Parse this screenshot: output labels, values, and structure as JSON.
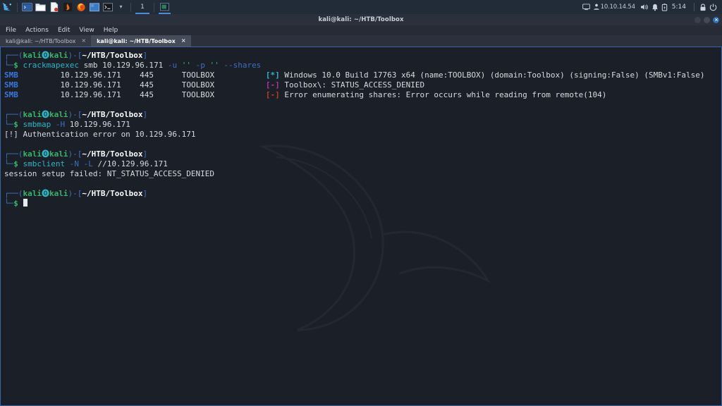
{
  "taskbar": {
    "left_items": [
      {
        "name": "kali-menu-icon",
        "label": "Kali Menu"
      },
      {
        "name": "terminal-emulator-icon",
        "label": "Terminal Emulator"
      },
      {
        "name": "file-manager-icon",
        "label": "File Manager"
      },
      {
        "name": "text-editor-icon",
        "label": "Text Editor"
      },
      {
        "name": "burpsuite-icon",
        "label": "Burp Suite"
      },
      {
        "name": "firefox-icon",
        "label": "Firefox ESR"
      },
      {
        "name": "workspace-preview-icon",
        "label": "Workspace"
      },
      {
        "name": "terminal-window-icon",
        "label": "Terminal Window"
      }
    ],
    "dropdown_label": "▾",
    "workspace_number": "1",
    "open_window_label": "Terminal",
    "tray": {
      "display_icon": "display-icon",
      "network_icon": "network-icon",
      "ip_address": "10.10.14.54",
      "volume_icon": "volume-icon",
      "notification_icon": "bell-icon",
      "battery_icon": "battery-icon",
      "clock": "5:14",
      "lock_icon": "lock-icon",
      "power_icon": "power-icon"
    }
  },
  "window": {
    "title": "kali@kali: ~/HTB/Toolbox",
    "controls": {
      "minimize": "minimize-button",
      "maximize": "maximize-button",
      "close": "close-button"
    },
    "menu": [
      {
        "label": "File"
      },
      {
        "label": "Actions"
      },
      {
        "label": "Edit"
      },
      {
        "label": "View"
      },
      {
        "label": "Help"
      }
    ],
    "tabs": [
      {
        "label": "kali@kali: ~/HTB/Toolbox",
        "close": "×",
        "active": false
      },
      {
        "label": "kali@kali: ~/HTB/Toolbox",
        "close": "×",
        "active": true
      }
    ]
  },
  "terminal": {
    "prompt": {
      "open_paren": "(",
      "user": "kali",
      "at_glyph": "⓿",
      "host": "kali",
      "close_paren": ")",
      "dash": "-",
      "bracket_open": "[",
      "path": "~/HTB/Toolbox",
      "bracket_close": "]",
      "dollar": "$"
    },
    "blocks": [
      {
        "id": "crackmapexec-block",
        "command": {
          "cmd": "crackmapexec",
          "args_plain_1": " smb 10.129.96.171 ",
          "flag_u": "-u",
          "quote_1": " '' ",
          "flag_p": "-p",
          "quote_2": " '' ",
          "flag_shares": "--shares"
        },
        "output_rows": [
          {
            "proto": "SMB",
            "host": "10.129.96.171",
            "port": "445",
            "name": "TOOLBOX",
            "marker": "[*]",
            "marker_style": "star",
            "message": "Windows 10.0 Build 17763 x64 (name:TOOLBOX) (domain:Toolbox) (signing:False) (SMBv1:False)"
          },
          {
            "proto": "SMB",
            "host": "10.129.96.171",
            "port": "445",
            "name": "TOOLBOX",
            "marker": "[-]",
            "marker_style": "magenta",
            "message": "Toolbox\\: STATUS_ACCESS_DENIED"
          },
          {
            "proto": "SMB",
            "host": "10.129.96.171",
            "port": "445",
            "name": "TOOLBOX",
            "marker": "[-]",
            "marker_style": "red",
            "message": "Error enumerating shares: Error occurs while reading from remote(104)"
          }
        ]
      },
      {
        "id": "smbmap-block",
        "command": {
          "cmd": "smbmap",
          "args_plain_1": " ",
          "flag_u": "-H",
          "quote_1": " 10.129.96.171",
          "flag_p": "",
          "quote_2": "",
          "flag_shares": ""
        },
        "plain_output": [
          "[!] Authentication error on 10.129.96.171"
        ]
      },
      {
        "id": "smbclient-block",
        "command": {
          "cmd": "smbclient",
          "args_plain_1": " ",
          "flag_u": "-N",
          "quote_1": " ",
          "flag_p": "-L",
          "quote_2": " //10.129.96.171",
          "flag_shares": ""
        },
        "plain_output": [
          "session setup failed: NT_STATUS_ACCESS_DENIED"
        ]
      }
    ],
    "final_prompt_cursor": true
  },
  "colors": {
    "accent_blue": "#3a62a8",
    "prompt_green": "#36b56a",
    "cmd_cyan": "#2fb4c4",
    "smb_blue": "#3a76d8",
    "marker_magenta": "#b0359c",
    "marker_red": "#c0392b",
    "terminal_bg": "#1b2028",
    "taskbar_bg": "#222b38"
  }
}
